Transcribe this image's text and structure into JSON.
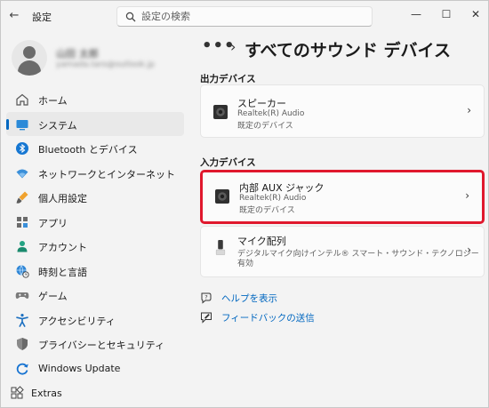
{
  "window": {
    "title": "設定",
    "controls": {
      "minimize": "—",
      "maximize": "☐",
      "close": "✕"
    }
  },
  "search": {
    "placeholder": "設定の検索",
    "value": ""
  },
  "profile": {
    "name": "山田 太郎",
    "email": "yamada.taro@outlook.jp"
  },
  "sidebar": {
    "items": [
      {
        "label": "ホーム",
        "icon": "home-icon",
        "active": false
      },
      {
        "label": "システム",
        "icon": "system-display-icon",
        "active": true
      },
      {
        "label": "Bluetooth とデバイス",
        "icon": "bluetooth-icon",
        "active": false
      },
      {
        "label": "ネットワークとインターネット",
        "icon": "wifi-icon",
        "active": false
      },
      {
        "label": "個人用設定",
        "icon": "brush-icon",
        "active": false
      },
      {
        "label": "アプリ",
        "icon": "apps-icon",
        "active": false
      },
      {
        "label": "アカウント",
        "icon": "account-icon",
        "active": false
      },
      {
        "label": "時刻と言語",
        "icon": "globe-clock-icon",
        "active": false
      },
      {
        "label": "ゲーム",
        "icon": "gamepad-icon",
        "active": false
      },
      {
        "label": "アクセシビリティ",
        "icon": "accessibility-icon",
        "active": false
      },
      {
        "label": "プライバシーとセキュリティ",
        "icon": "shield-icon",
        "active": false
      },
      {
        "label": "Windows Update",
        "icon": "windows-update-icon",
        "active": false
      }
    ],
    "extras": {
      "label": "Extras",
      "icon": "extras-icon"
    }
  },
  "main": {
    "breadcrumb_more": "•••",
    "title": "すべてのサウンド デバイス",
    "output_section": {
      "heading": "出力デバイス",
      "devices": [
        {
          "name": "スピーカー",
          "driver": "Realtek(R) Audio",
          "status": "既定のデバイス",
          "icon": "speaker-icon"
        }
      ]
    },
    "input_section": {
      "heading": "入力デバイス",
      "devices": [
        {
          "name": "内部 AUX ジャック",
          "driver": "Realtek(R) Audio",
          "status": "既定のデバイス",
          "icon": "aux-jack-icon",
          "highlighted": true
        },
        {
          "name": "マイク配列",
          "driver": "デジタルマイク向けインテル® スマート・サウンド・テクノロジー",
          "status": "有効",
          "icon": "microphone-icon",
          "highlighted": false
        }
      ]
    },
    "links": [
      {
        "label": "ヘルプを表示",
        "icon": "help-icon"
      },
      {
        "label": "フィードバックの送信",
        "icon": "feedback-icon"
      }
    ]
  },
  "colors": {
    "accent": "#0067c0",
    "highlight_border": "#e0182d",
    "window_bg": "#f3f3f3",
    "card_bg": "#fbfbfb"
  }
}
